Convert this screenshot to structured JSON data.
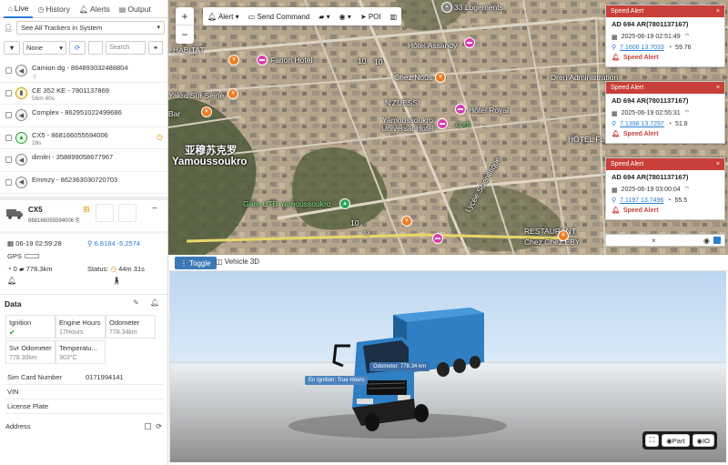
{
  "tabs": [
    {
      "label": "Live",
      "icon": "home-icon"
    },
    {
      "label": "History",
      "icon": "clock-icon"
    },
    {
      "label": "Alerts",
      "icon": "bell-icon"
    },
    {
      "label": "Output",
      "icon": "document-icon"
    }
  ],
  "tracker_select": {
    "value": "See All Trackers in System"
  },
  "filter": {
    "select_value": "None",
    "search_placeholder": "Search"
  },
  "vehicles": [
    {
      "name": "Camion dg - 864893032488804",
      "sub": ""
    },
    {
      "name": "CE 352 KE - 7801137869",
      "sub": "56m 40s"
    },
    {
      "name": "Complex - 862951022499686",
      "sub": ""
    },
    {
      "name": "CX5 - 868166055594006",
      "sub": "29s"
    },
    {
      "name": "dimitri - 358899058677967",
      "sub": ""
    },
    {
      "name": "Emmzy - 862363030720703",
      "sub": ""
    }
  ],
  "device": {
    "name": "CX5",
    "id": "868166055594006",
    "datetime": "06-19 02:59:28",
    "coords": "6.8184 -5.2574",
    "gps_label": "GPS",
    "speed_value": "0",
    "odometer": "778.3km",
    "status_label": "Status:",
    "status_duration": "44m 31s"
  },
  "data_section": {
    "title": "Data",
    "cells": [
      {
        "label": "Ignition",
        "value": "✔"
      },
      {
        "label": "Engine Hours",
        "value": "17Hours"
      },
      {
        "label": "Odometer",
        "value": "778.34km"
      },
      {
        "label": "Svr Odometer",
        "value": "778.30km"
      },
      {
        "label": "Temperatu...",
        "value": "303°C"
      }
    ],
    "kv": [
      {
        "key": "Sim Card Number",
        "value": "0171994141"
      },
      {
        "key": "VIN",
        "value": ""
      },
      {
        "key": "License Plate",
        "value": ""
      }
    ],
    "address_label": "Address"
  },
  "map": {
    "toolbar": {
      "alert": "Alert",
      "send_command": "Send Command",
      "poi": "POI"
    },
    "zoom_in": "+",
    "zoom_out": "−",
    "labels": {
      "logements": "33 Logements",
      "habitat": "HABITAT",
      "fanon": "Fanon Hotel",
      "assandy": "Hôtel Assandy",
      "road10a": "10",
      "road10b": "10",
      "road10c": "10",
      "chez_nous": "Chez Nous",
      "dren": "Dren Administration",
      "yakro": "Yakro Sur Seine",
      "nzuessi": "N'ZUESSI",
      "royal": "Hôtel Royal",
      "hotel_city": "Yamoussoukro Universal Hotel",
      "cx5": "CX5",
      "bar": "Bar",
      "hotel_fl": "HÔTEL FL",
      "city_cn": "亚穆苏克罗",
      "city": "Yamoussoukro",
      "gare": "Gare UTB Yamoussoukro",
      "restaurant": "RESTAURANT",
      "chez_eby": "Chez Chez EBY",
      "lycee": "Lycée Scientifique",
      "a3": "A3"
    }
  },
  "alerts": [
    {
      "title": "Speed Alert",
      "vehicle": "AD 694 AR(7801137167)",
      "datetime": "2025-06-19 02:51:49",
      "coords": "7.1600 13.7033",
      "speed": "59.76",
      "type": "Speed Alert"
    },
    {
      "title": "Speed Alert",
      "vehicle": "AD 694 AR(7801137167)",
      "datetime": "2025-06-19 02:55:31",
      "coords": "7.1398 13.7297",
      "speed": "51.8",
      "type": "Speed Alert"
    },
    {
      "title": "Speed Alert",
      "vehicle": "AD 694 AR(7801137167)",
      "datetime": "2025-06-19 03:00:04",
      "coords": "7.1197 13.7496",
      "speed": "55.5",
      "type": "Speed Alert"
    }
  ],
  "view3d": {
    "toggle_label": "Toggle",
    "tab_label": "Vehicle 3D",
    "odometer_tip": "Odometer: 778.34 km",
    "ignition_tip": "Ignition: True",
    "engine_tip": "En",
    "hours_tip": "Hours",
    "part_btn": "Part",
    "io_btn": "IO"
  },
  "colors": {
    "accent": "#2a7bd4",
    "alert_red": "#c9403a",
    "warning": "#e69300",
    "truck_blue": "#2f7fc2"
  }
}
